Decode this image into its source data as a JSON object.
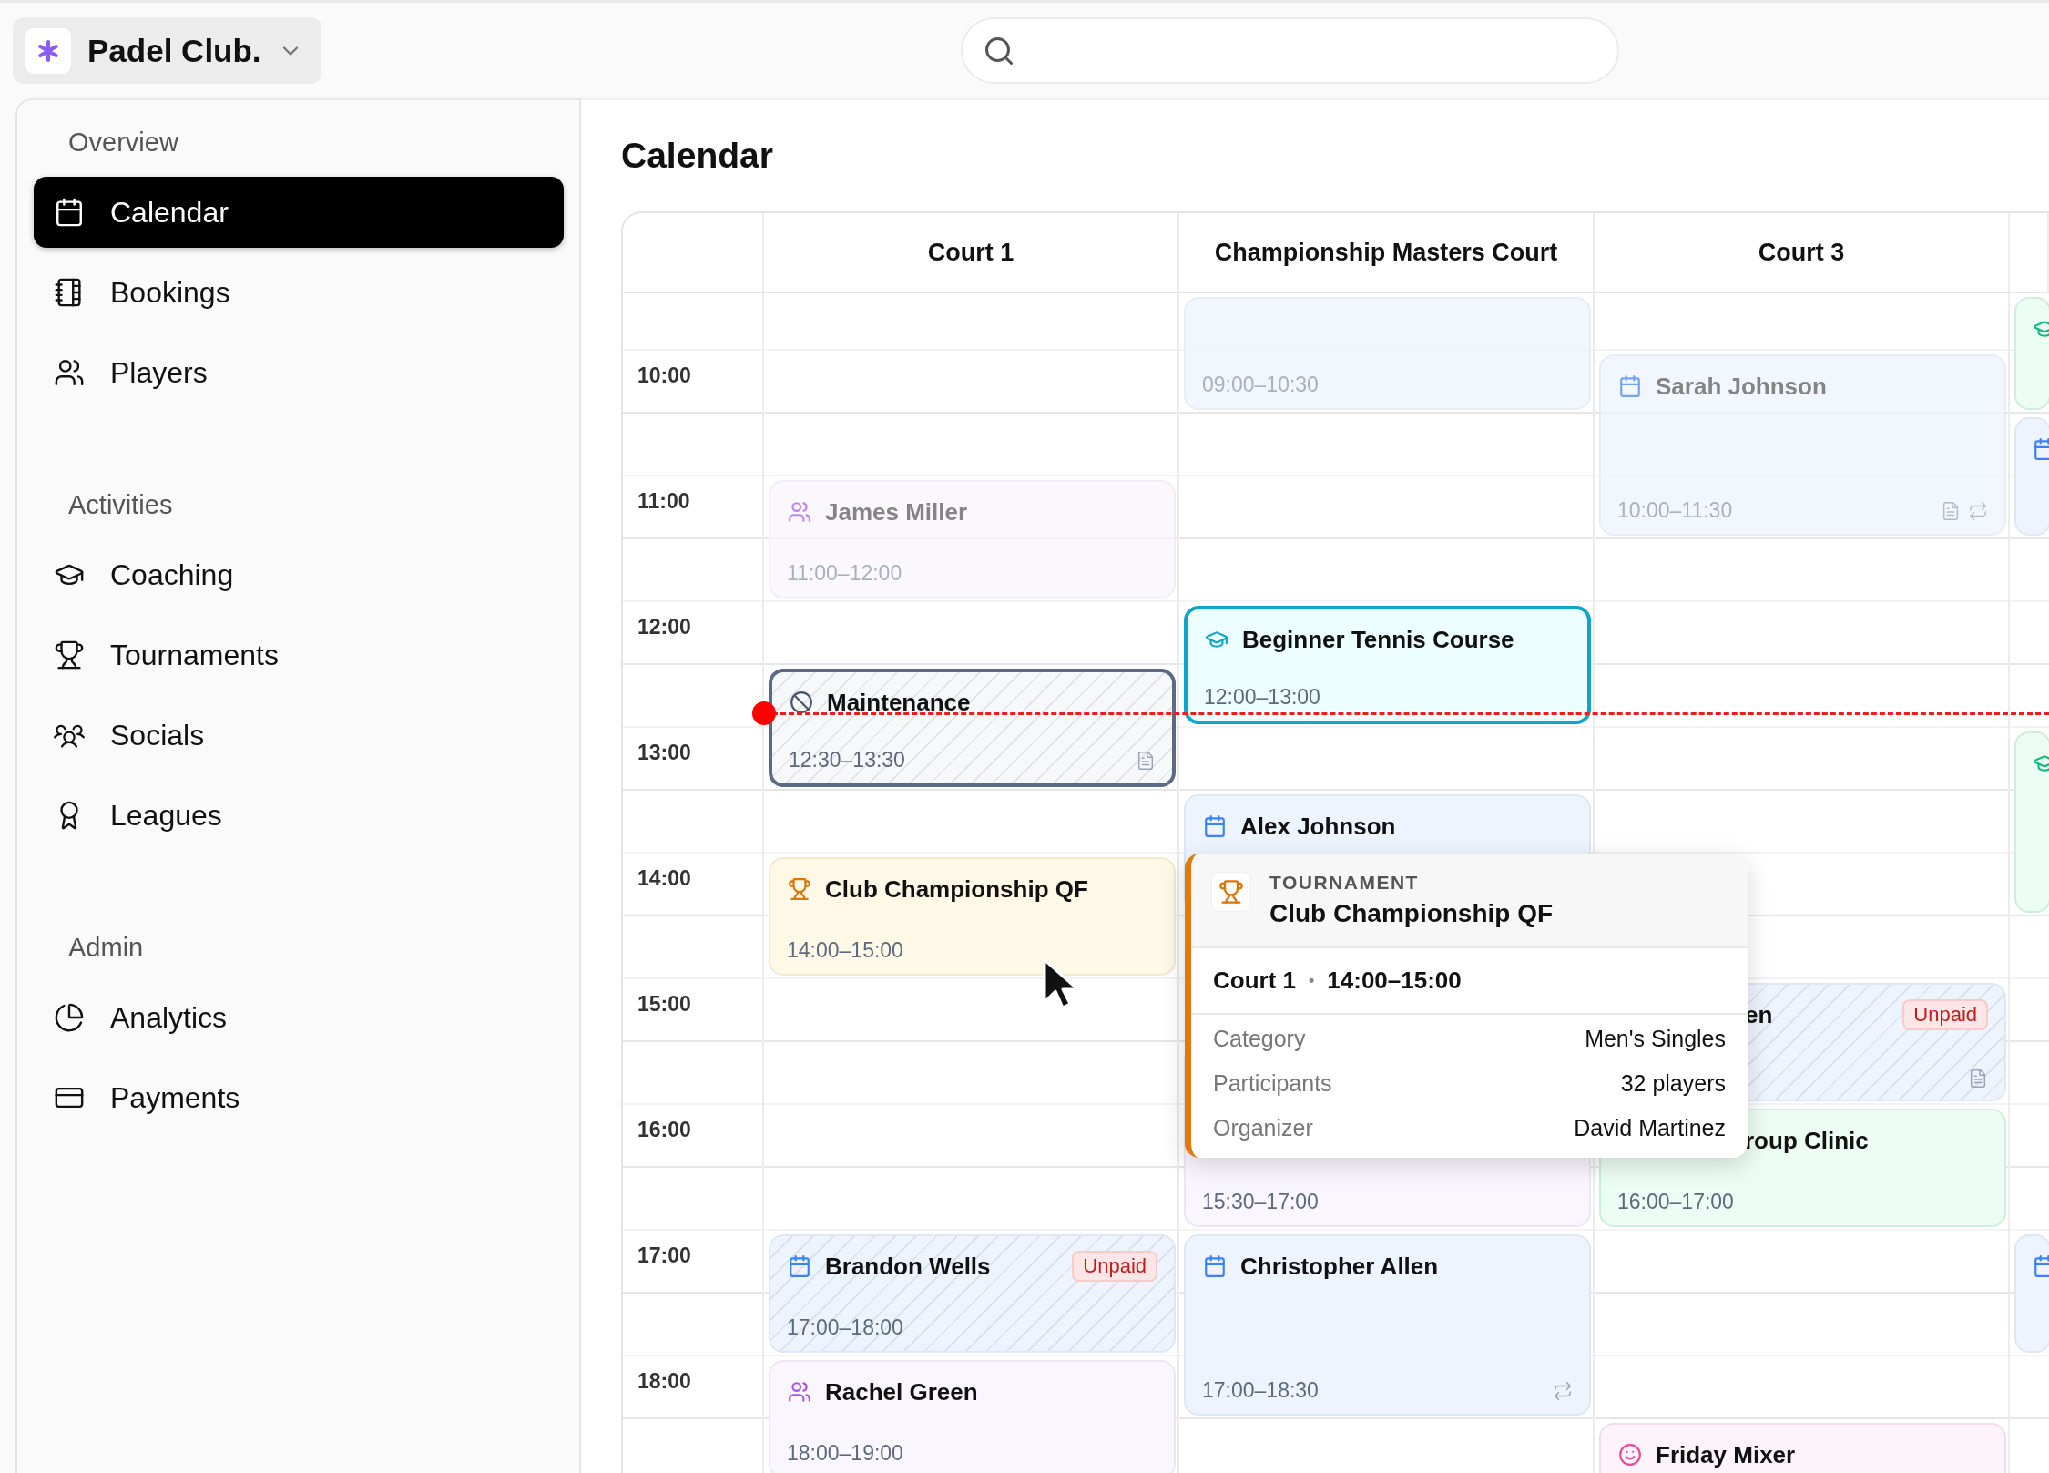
{
  "app": {
    "name": "Padel Club."
  },
  "sidebar": {
    "sections": [
      {
        "title": "Overview",
        "items": [
          {
            "label": "Calendar",
            "selected": true
          },
          {
            "label": "Bookings",
            "selected": false
          },
          {
            "label": "Players",
            "selected": false
          }
        ]
      },
      {
        "title": "Activities",
        "items": [
          {
            "label": "Coaching",
            "selected": false
          },
          {
            "label": "Tournaments",
            "selected": false
          },
          {
            "label": "Socials",
            "selected": false
          },
          {
            "label": "Leagues",
            "selected": false
          }
        ]
      },
      {
        "title": "Admin",
        "items": [
          {
            "label": "Analytics",
            "selected": false
          },
          {
            "label": "Payments",
            "selected": false
          }
        ]
      }
    ]
  },
  "page": {
    "title": "Calendar"
  },
  "calendar": {
    "hours": [
      "10:00",
      "11:00",
      "12:00",
      "13:00",
      "14:00",
      "15:00",
      "16:00",
      "17:00",
      "18:00"
    ],
    "courts": [
      {
        "name": "Court 1",
        "events": [
          {
            "kind": "group",
            "name": "James Miller",
            "time": "11:00–12:00",
            "past": true,
            "current": false
          },
          {
            "kind": "maintenance",
            "name": "Maintenance",
            "time": "12:30–13:30",
            "past": false,
            "current": true,
            "notes": true
          },
          {
            "kind": "tournament",
            "name": "Club Championship QF",
            "time": "14:00–15:00",
            "past": false,
            "current": false
          },
          {
            "kind": "booking",
            "name": "Brandon Wells",
            "time": "17:00–18:00",
            "badge": "Unpaid",
            "past": false,
            "current": false
          },
          {
            "kind": "group",
            "name": "Rachel Green",
            "time": "18:00–19:00",
            "past": false,
            "current": false
          }
        ]
      },
      {
        "name": "Championship Masters Court",
        "events": [
          {
            "kind": "booking",
            "time": "09:00–10:30",
            "past": true,
            "current": false
          },
          {
            "kind": "coaching",
            "name": "Beginner Tennis Course",
            "time": "12:00–13:00",
            "past": false,
            "current": true
          },
          {
            "kind": "booking",
            "name": "Alex Johnson",
            "past": false,
            "current": false
          },
          {
            "kind": "group",
            "time": "15:30–17:00",
            "past": false,
            "current": false
          },
          {
            "kind": "booking",
            "name": "Christopher Allen",
            "time": "17:00–18:30",
            "past": false,
            "current": false,
            "recurring": true
          }
        ]
      },
      {
        "name": "Court 3",
        "events": [
          {
            "kind": "booking",
            "name": "Sarah Johnson",
            "time": "10:00–11:30",
            "past": true,
            "current": false,
            "notes": true,
            "recurring": true
          },
          {
            "kind": "booking",
            "name": "en",
            "badge": "Unpaid",
            "past": false,
            "current": false,
            "covered": true,
            "notes": true
          },
          {
            "kind": "coaching",
            "name": "roup Clinic",
            "time": "16:00–17:00",
            "past": false,
            "current": false,
            "covered": true
          },
          {
            "kind": "social",
            "name": "Friday Mixer",
            "past": false,
            "current": false
          }
        ]
      },
      {
        "events": [
          {
            "kind": "coaching",
            "past": false,
            "current": false
          },
          {
            "kind": "booking",
            "past": false,
            "current": false
          },
          {
            "kind": "coaching",
            "past": false,
            "current": false
          },
          {
            "kind": "booking",
            "past": false,
            "current": false
          }
        ]
      }
    ]
  },
  "popover": {
    "category": "TOURNAMENT",
    "title": "Club Championship QF",
    "court": "Court 1",
    "separator": "•",
    "time": "14:00–15:00",
    "details": [
      {
        "label": "Category",
        "value": "Men's Singles"
      },
      {
        "label": "Participants",
        "value": "32 players"
      },
      {
        "label": "Organizer",
        "value": "David Martinez"
      }
    ]
  }
}
